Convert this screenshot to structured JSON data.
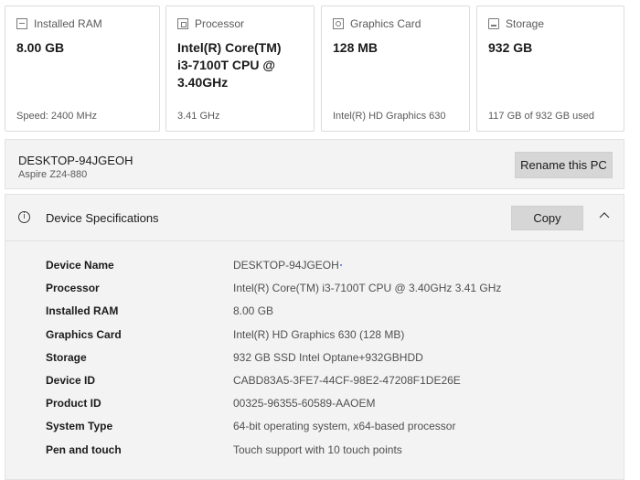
{
  "cards": [
    {
      "label": "Installed RAM",
      "icon": "ram-icon",
      "value": "8.00 GB",
      "sub": "Speed: 2400 MHz"
    },
    {
      "label": "Processor",
      "icon": "processor-icon",
      "value": "Intel(R) Core(TM) i3-7100T CPU @ 3.40GHz",
      "sub": "3.41 GHz"
    },
    {
      "label": "Graphics Card",
      "icon": "graphics-card-icon",
      "value": "128 MB",
      "sub": "Intel(R) HD Graphics 630"
    },
    {
      "label": "Storage",
      "icon": "storage-icon",
      "value": "932 GB",
      "sub": "117 GB of 932 GB used"
    }
  ],
  "pc": {
    "name": "DESKTOP-94JGEOH",
    "model": "Aspire Z24-880",
    "rename_label": "Rename this PC"
  },
  "specs": {
    "title": "Device Specifications",
    "copy_label": "Copy",
    "rows": [
      {
        "key": "Device Name",
        "value": "DESKTOP-94JGEOH"
      },
      {
        "key": "Processor",
        "value": "Intel(R) Core(TM) i3-7100T CPU @ 3.40GHz   3.41 GHz"
      },
      {
        "key": "Installed RAM",
        "value": "8.00 GB"
      },
      {
        "key": "Graphics Card",
        "value": "Intel(R) HD Graphics 630 (128 MB)"
      },
      {
        "key": "Storage",
        "value": "932 GB SSD Intel Optane+932GBHDD"
      },
      {
        "key": "Device ID",
        "value": "CABD83A5-3FE7-44CF-98E2-47208F1DE26E"
      },
      {
        "key": "Product ID",
        "value": "00325-96355-60589-AAOEM"
      },
      {
        "key": "System Type",
        "value": "64-bit operating system, x64-based processor"
      },
      {
        "key": "Pen and touch",
        "value": "Touch support with 10 touch points"
      }
    ]
  },
  "colors": {
    "button_bg": "#d6d6d6",
    "panel_bg": "#f3f3f3"
  }
}
